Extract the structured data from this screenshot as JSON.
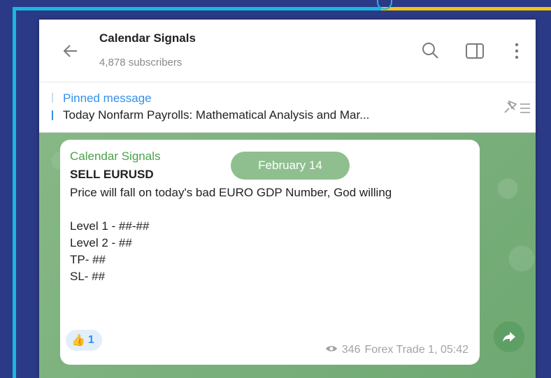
{
  "header": {
    "title": "Calendar Signals",
    "subscribers": "4,878 subscribers",
    "icons": [
      "back-arrow-icon",
      "search-icon",
      "sidebar-toggle-icon",
      "more-vertical-icon"
    ]
  },
  "pinned": {
    "title": "Pinned message",
    "text": "Today Nonfarm Payrolls: Mathematical Analysis and Mar...",
    "icon": "pin-list-icon"
  },
  "message": {
    "sender": "Calendar Signals",
    "headline": "SELL EURUSD",
    "body": "Price will fall on today's bad EURO GDP Number, God willing\n\nLevel 1 - ##-##\nLevel 2 - ##\nTP- ##\nSL- ##",
    "date_pill": "February 14",
    "reaction_emoji": "👍",
    "reaction_count": "1",
    "views": "346",
    "author_time": "Forex Trade 1, 05:42"
  },
  "colors": {
    "accent": "#3390ec",
    "sender": "#4aa14a",
    "chat_bg": "#7fb37f",
    "frame_cyan": "#19b7e0",
    "frame_yellow": "#f2c40c",
    "page_bg": "#2b3a86"
  }
}
